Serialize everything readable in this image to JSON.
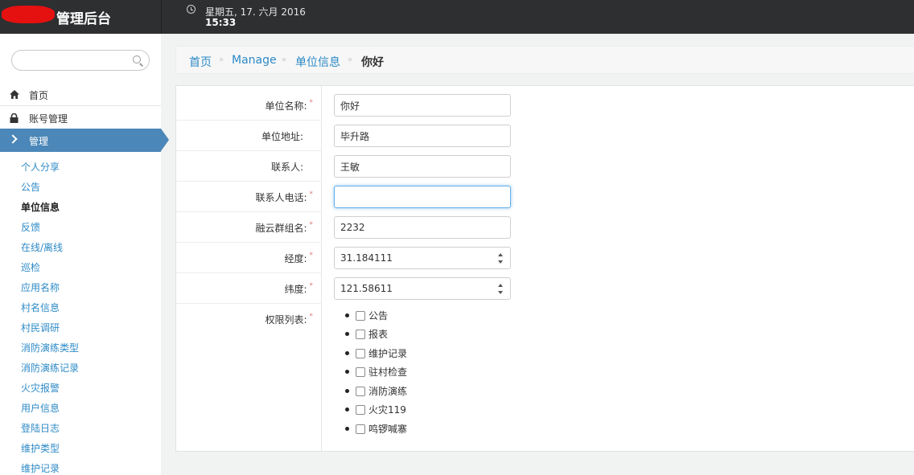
{
  "header": {
    "app_title": "管理后台",
    "date": "星期五, 17. 六月 2016",
    "time": "15:33"
  },
  "sidebar": {
    "search_placeholder": "",
    "top_items": [
      {
        "label": "首页",
        "icon": "home-icon"
      },
      {
        "label": "账号管理",
        "icon": "lock-icon"
      }
    ],
    "active_section": {
      "label": "管理",
      "icon": "chevron-right-icon"
    },
    "sub_items": [
      {
        "label": "个人分享"
      },
      {
        "label": "公告"
      },
      {
        "label": "单位信息",
        "current": true
      },
      {
        "label": "反馈"
      },
      {
        "label": "在线/离线"
      },
      {
        "label": "巡检"
      },
      {
        "label": "应用名称"
      },
      {
        "label": "村名信息"
      },
      {
        "label": "村民调研"
      },
      {
        "label": "消防演练类型"
      },
      {
        "label": "消防演练记录"
      },
      {
        "label": "火灾报警"
      },
      {
        "label": "用户信息"
      },
      {
        "label": "登陆日志"
      },
      {
        "label": "维护类型"
      },
      {
        "label": "维护记录"
      }
    ]
  },
  "breadcrumb": {
    "items": [
      "首页",
      "Manage",
      "单位信息",
      "你好"
    ],
    "separator": "»"
  },
  "form": {
    "required_mark": "*",
    "fields": [
      {
        "label": "单位名称:",
        "value": "你好",
        "required": true
      },
      {
        "label": "单位地址:",
        "value": "毕升路",
        "required": false
      },
      {
        "label": "联系人:",
        "value": "王敏",
        "required": false
      },
      {
        "label": "联系人电话:",
        "value": "",
        "required": true,
        "focused": true
      },
      {
        "label": "融云群组名:",
        "value": "2232",
        "required": true
      },
      {
        "label": "经度:",
        "value": "31.184111",
        "required": true,
        "type": "number"
      },
      {
        "label": "纬度:",
        "value": "121.58611",
        "required": true,
        "type": "number"
      }
    ],
    "permissions": {
      "label": "权限列表:",
      "required": true,
      "items": [
        "公告",
        "报表",
        "维护记录",
        "驻村检查",
        "消防演练",
        "火灾119",
        "鸣锣喊寨"
      ]
    }
  },
  "colors": {
    "topbar": "#2e2f31",
    "accent": "#4b87b8",
    "link": "#2d8ac7",
    "required": "#e07b7b"
  }
}
